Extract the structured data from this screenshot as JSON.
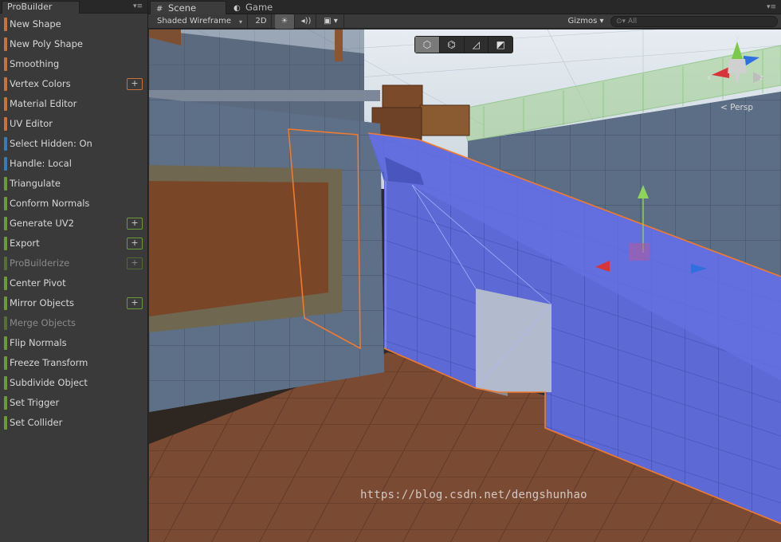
{
  "probuilder": {
    "tab_title": "ProBuilder",
    "menu_glyph": "▾≡",
    "items": [
      {
        "label": "New Shape",
        "color": "orange",
        "plus": false,
        "disabled": false
      },
      {
        "label": "New Poly Shape",
        "color": "orange",
        "plus": false,
        "disabled": false
      },
      {
        "label": "Smoothing",
        "color": "orange",
        "plus": false,
        "disabled": false
      },
      {
        "label": "Vertex Colors",
        "color": "orange",
        "plus": true,
        "disabled": false
      },
      {
        "label": "Material Editor",
        "color": "orange",
        "plus": false,
        "disabled": false
      },
      {
        "label": "UV Editor",
        "color": "orange",
        "plus": false,
        "disabled": false
      },
      {
        "label": "Select Hidden: On",
        "color": "blue",
        "plus": false,
        "disabled": false
      },
      {
        "label": "Handle: Local",
        "color": "blue",
        "plus": false,
        "disabled": false
      },
      {
        "label": "Triangulate",
        "color": "green",
        "plus": false,
        "disabled": false
      },
      {
        "label": "Conform Normals",
        "color": "green",
        "plus": false,
        "disabled": false
      },
      {
        "label": "Generate UV2",
        "color": "green",
        "plus": true,
        "disabled": false
      },
      {
        "label": "Export",
        "color": "green",
        "plus": true,
        "disabled": false
      },
      {
        "label": "ProBuilderize",
        "color": "green",
        "plus": true,
        "disabled": true
      },
      {
        "label": "Center Pivot",
        "color": "green",
        "plus": false,
        "disabled": false
      },
      {
        "label": "Mirror Objects",
        "color": "green",
        "plus": true,
        "disabled": false
      },
      {
        "label": "Merge Objects",
        "color": "green",
        "plus": false,
        "disabled": true
      },
      {
        "label": "Flip Normals",
        "color": "green",
        "plus": false,
        "disabled": false
      },
      {
        "label": "Freeze Transform",
        "color": "green",
        "plus": false,
        "disabled": false
      },
      {
        "label": "Subdivide Object",
        "color": "green",
        "plus": false,
        "disabled": false
      },
      {
        "label": "Set Trigger",
        "color": "green",
        "plus": false,
        "disabled": false
      },
      {
        "label": "Set Collider",
        "color": "green",
        "plus": false,
        "disabled": false
      }
    ],
    "plus_label": "+"
  },
  "colors": {
    "orange": "#c8713a",
    "blue": "#3a7bb5",
    "green": "#6a9b37",
    "selection": "#f07a30",
    "selected_face": "#5a68d8"
  },
  "scene": {
    "tab_scene": "Scene",
    "tab_scene_icon": "#",
    "tab_game": "Game",
    "tab_game_icon": "◐",
    "menu_glyph": "▾≡",
    "toolbar": {
      "shading_mode": "Shaded Wireframe",
      "two_d": "2D",
      "lighting_icon": "☀",
      "audio_icon": "◂))",
      "effects_icon": "▣ ▾",
      "gizmos": "Gizmos ▾",
      "search_placeholder": "All",
      "search_icon": "⊙▾"
    },
    "probuilder_tools": [
      "⬡",
      "⌬",
      "◿",
      "◩"
    ],
    "active_tool_index": 0,
    "gizmo": {
      "x_label": "x",
      "y_label": "y",
      "z_label": "z",
      "projection": "< Persp"
    }
  },
  "watermark": "https://blog.csdn.net/dengshunhao"
}
